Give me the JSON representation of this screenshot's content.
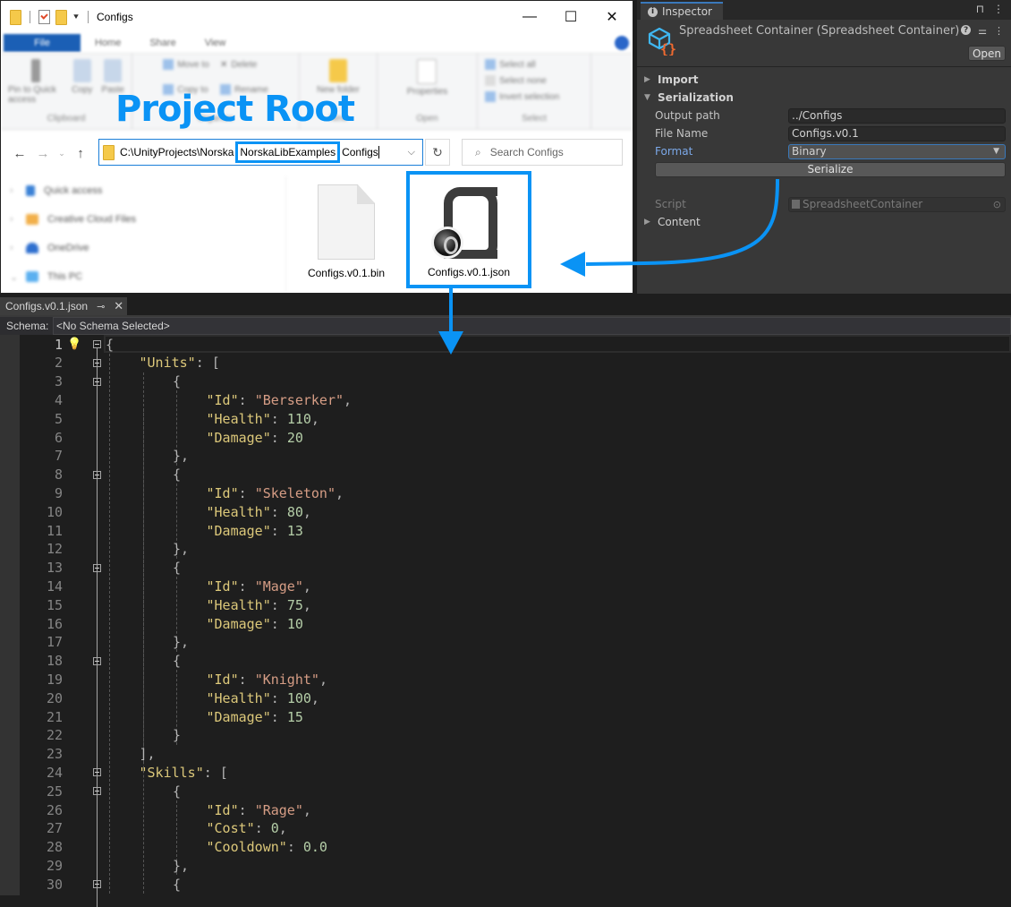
{
  "explorer": {
    "title": "Configs",
    "window_controls": {
      "minimize": "—",
      "maximize": "☐",
      "close": "✕"
    },
    "ribbon_tabs": [
      "File",
      "Home",
      "Share",
      "View"
    ],
    "ribbon_groups": [
      {
        "label": "Clipboard",
        "items": [
          "Pin to Quick access",
          "Copy",
          "Paste"
        ]
      },
      {
        "label": "Organize",
        "items": [
          "Move to",
          "Copy to",
          "Delete",
          "Rename"
        ]
      },
      {
        "label": "New",
        "items": [
          "New folder"
        ]
      },
      {
        "label": "Open",
        "items": [
          "Properties"
        ]
      },
      {
        "label": "Select",
        "items": [
          "Select all",
          "Select none",
          "Invert selection"
        ]
      }
    ],
    "annotation": "Project Root",
    "address": {
      "prefix": "C:\\UnityProjects\\Norska",
      "highlighted_segment": "NorskaLibExamples",
      "suffix": "Configs"
    },
    "search_placeholder": "Search Configs",
    "nav_pane": [
      "Quick access",
      "Creative Cloud Files",
      "OneDrive",
      "This PC"
    ],
    "files": [
      {
        "name": "Configs.v0.1.bin",
        "type": "bin",
        "selected": false
      },
      {
        "name": "Configs.v0.1.json",
        "type": "json",
        "selected": true
      }
    ]
  },
  "inspector": {
    "tab_label": "Inspector",
    "component_title": "Spreadsheet Container (Spreadsheet Container)",
    "open_button": "Open",
    "sections": {
      "import": "Import",
      "serialization": "Serialization",
      "content": "Content"
    },
    "fields": {
      "output_path": {
        "label": "Output path",
        "value": "../Configs"
      },
      "file_name": {
        "label": "File Name",
        "value": "Configs.v0.1"
      },
      "format": {
        "label": "Format",
        "value": "Binary"
      },
      "script": {
        "label": "Script",
        "value": "SpreadsheetContainer"
      }
    },
    "serialize_button": "Serialize"
  },
  "editor": {
    "tab_label": "Configs.v0.1.json",
    "schema_label": "Schema:",
    "schema_value": "<No Schema Selected>",
    "lines": [
      {
        "n": "1",
        "indent": 0,
        "tokens": [
          [
            "p",
            "{"
          ]
        ],
        "fold": true
      },
      {
        "n": "2",
        "indent": 1,
        "tokens": [
          [
            "k",
            "\"Units\""
          ],
          [
            "p",
            ": ["
          ]
        ],
        "fold": true
      },
      {
        "n": "3",
        "indent": 2,
        "tokens": [
          [
            "p",
            "{"
          ]
        ],
        "fold": true
      },
      {
        "n": "4",
        "indent": 3,
        "tokens": [
          [
            "k",
            "\"Id\""
          ],
          [
            "p",
            ": "
          ],
          [
            "s",
            "\"Berserker\""
          ],
          [
            "p",
            ","
          ]
        ]
      },
      {
        "n": "5",
        "indent": 3,
        "tokens": [
          [
            "k",
            "\"Health\""
          ],
          [
            "p",
            ": "
          ],
          [
            "n",
            "110"
          ],
          [
            "p",
            ","
          ]
        ]
      },
      {
        "n": "6",
        "indent": 3,
        "tokens": [
          [
            "k",
            "\"Damage\""
          ],
          [
            "p",
            ": "
          ],
          [
            "n",
            "20"
          ]
        ]
      },
      {
        "n": "7",
        "indent": 2,
        "tokens": [
          [
            "p",
            "},"
          ]
        ]
      },
      {
        "n": "8",
        "indent": 2,
        "tokens": [
          [
            "p",
            "{"
          ]
        ],
        "fold": true
      },
      {
        "n": "9",
        "indent": 3,
        "tokens": [
          [
            "k",
            "\"Id\""
          ],
          [
            "p",
            ": "
          ],
          [
            "s",
            "\"Skeleton\""
          ],
          [
            "p",
            ","
          ]
        ]
      },
      {
        "n": "10",
        "indent": 3,
        "tokens": [
          [
            "k",
            "\"Health\""
          ],
          [
            "p",
            ": "
          ],
          [
            "n",
            "80"
          ],
          [
            "p",
            ","
          ]
        ]
      },
      {
        "n": "11",
        "indent": 3,
        "tokens": [
          [
            "k",
            "\"Damage\""
          ],
          [
            "p",
            ": "
          ],
          [
            "n",
            "13"
          ]
        ]
      },
      {
        "n": "12",
        "indent": 2,
        "tokens": [
          [
            "p",
            "},"
          ]
        ]
      },
      {
        "n": "13",
        "indent": 2,
        "tokens": [
          [
            "p",
            "{"
          ]
        ],
        "fold": true
      },
      {
        "n": "14",
        "indent": 3,
        "tokens": [
          [
            "k",
            "\"Id\""
          ],
          [
            "p",
            ": "
          ],
          [
            "s",
            "\"Mage\""
          ],
          [
            "p",
            ","
          ]
        ]
      },
      {
        "n": "15",
        "indent": 3,
        "tokens": [
          [
            "k",
            "\"Health\""
          ],
          [
            "p",
            ": "
          ],
          [
            "n",
            "75"
          ],
          [
            "p",
            ","
          ]
        ]
      },
      {
        "n": "16",
        "indent": 3,
        "tokens": [
          [
            "k",
            "\"Damage\""
          ],
          [
            "p",
            ": "
          ],
          [
            "n",
            "10"
          ]
        ]
      },
      {
        "n": "17",
        "indent": 2,
        "tokens": [
          [
            "p",
            "},"
          ]
        ]
      },
      {
        "n": "18",
        "indent": 2,
        "tokens": [
          [
            "p",
            "{"
          ]
        ],
        "fold": true
      },
      {
        "n": "19",
        "indent": 3,
        "tokens": [
          [
            "k",
            "\"Id\""
          ],
          [
            "p",
            ": "
          ],
          [
            "s",
            "\"Knight\""
          ],
          [
            "p",
            ","
          ]
        ]
      },
      {
        "n": "20",
        "indent": 3,
        "tokens": [
          [
            "k",
            "\"Health\""
          ],
          [
            "p",
            ": "
          ],
          [
            "n",
            "100"
          ],
          [
            "p",
            ","
          ]
        ]
      },
      {
        "n": "21",
        "indent": 3,
        "tokens": [
          [
            "k",
            "\"Damage\""
          ],
          [
            "p",
            ": "
          ],
          [
            "n",
            "15"
          ]
        ]
      },
      {
        "n": "22",
        "indent": 2,
        "tokens": [
          [
            "p",
            "}"
          ]
        ]
      },
      {
        "n": "23",
        "indent": 1,
        "tokens": [
          [
            "p",
            "],"
          ]
        ]
      },
      {
        "n": "24",
        "indent": 1,
        "tokens": [
          [
            "k",
            "\"Skills\""
          ],
          [
            "p",
            ": ["
          ]
        ],
        "fold": true
      },
      {
        "n": "25",
        "indent": 2,
        "tokens": [
          [
            "p",
            "{"
          ]
        ],
        "fold": true
      },
      {
        "n": "26",
        "indent": 3,
        "tokens": [
          [
            "k",
            "\"Id\""
          ],
          [
            "p",
            ": "
          ],
          [
            "s",
            "\"Rage\""
          ],
          [
            "p",
            ","
          ]
        ]
      },
      {
        "n": "27",
        "indent": 3,
        "tokens": [
          [
            "k",
            "\"Cost\""
          ],
          [
            "p",
            ": "
          ],
          [
            "n",
            "0"
          ],
          [
            "p",
            ","
          ]
        ]
      },
      {
        "n": "28",
        "indent": 3,
        "tokens": [
          [
            "k",
            "\"Cooldown\""
          ],
          [
            "p",
            ": "
          ],
          [
            "n",
            "0.0"
          ]
        ]
      },
      {
        "n": "29",
        "indent": 2,
        "tokens": [
          [
            "p",
            "},"
          ]
        ]
      },
      {
        "n": "30",
        "indent": 2,
        "tokens": [
          [
            "p",
            "{"
          ]
        ],
        "fold": true
      }
    ]
  },
  "colors": {
    "annotation_blue": "#0a93f5",
    "json_key": "#dcc87a",
    "json_string": "#d69d85",
    "json_number": "#b5cea8",
    "inspector_bg": "#383838",
    "editor_bg": "#1e1e1e"
  }
}
